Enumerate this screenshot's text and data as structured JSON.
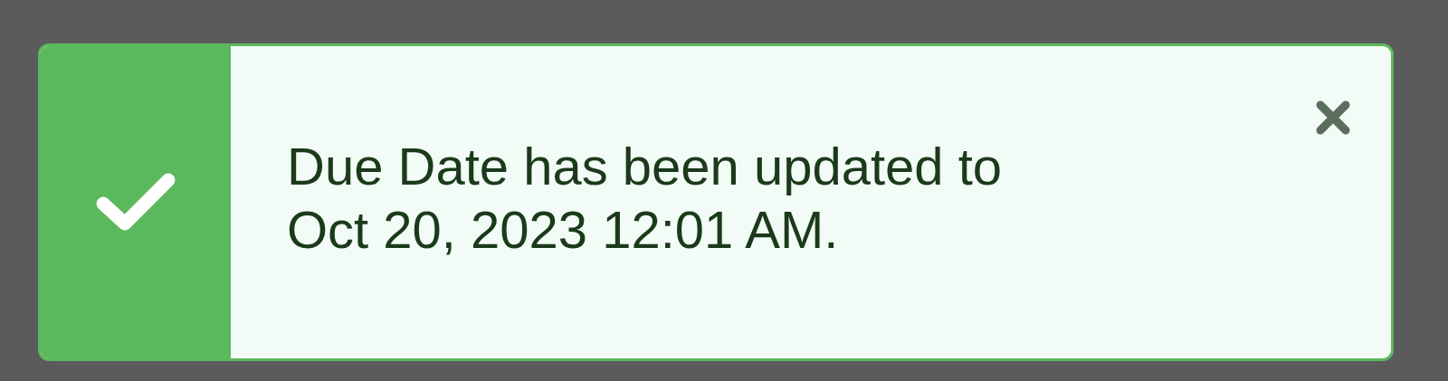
{
  "toast": {
    "kind": "success",
    "message": "Due Date has been updated to Oct 20, 2023 12:01 AM."
  }
}
